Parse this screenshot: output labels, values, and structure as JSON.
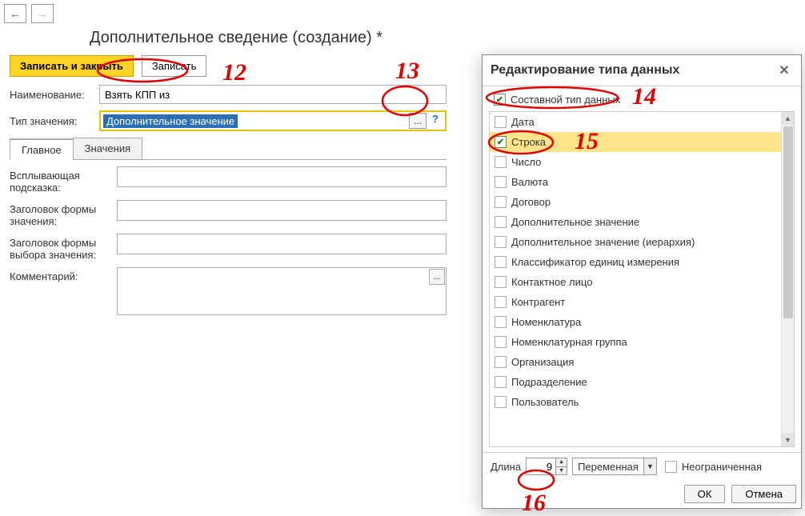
{
  "title": "Дополнительное сведение (создание) *",
  "actions": {
    "save_close": "Записать и закрыть",
    "save": "Записать"
  },
  "form": {
    "name_label": "Наименование:",
    "name_value": "Взять КПП из",
    "type_label": "Тип значения:",
    "type_value": "Дополнительное значение",
    "ellipsis": "...",
    "help": "?"
  },
  "tabs": {
    "main": "Главное",
    "values": "Значения"
  },
  "sub": {
    "tooltip_label": "Всплывающая подсказка:",
    "form_title_label": "Заголовок формы значения:",
    "choice_title_label": "Заголовок формы выбора значения:",
    "comment_label": "Комментарий:"
  },
  "popup": {
    "title": "Редактирование типа данных",
    "composite_label": "Составной тип данных",
    "types": [
      {
        "label": "Дата",
        "checked": false
      },
      {
        "label": "Строка",
        "checked": true,
        "highlight": true
      },
      {
        "label": "Число",
        "checked": false
      },
      {
        "label": "Валюта",
        "checked": false
      },
      {
        "label": "Договор",
        "checked": false
      },
      {
        "label": "Дополнительное значение",
        "checked": false
      },
      {
        "label": "Дополнительное значение (иерархия)",
        "checked": false
      },
      {
        "label": "Классификатор единиц измерения",
        "checked": false
      },
      {
        "label": "Контактное лицо",
        "checked": false
      },
      {
        "label": "Контрагент",
        "checked": false
      },
      {
        "label": "Номенклатура",
        "checked": false
      },
      {
        "label": "Номенклатурная группа",
        "checked": false
      },
      {
        "label": "Организация",
        "checked": false
      },
      {
        "label": "Подразделение",
        "checked": false
      },
      {
        "label": "Пользователь",
        "checked": false
      }
    ],
    "length_label": "Длина",
    "length_value": "9",
    "length_type": "Переменная",
    "unlimited_label": "Неограниченная",
    "ok": "ОК",
    "cancel": "Отмена"
  },
  "annotations": {
    "n12": "12",
    "n13": "13",
    "n14": "14",
    "n15": "15",
    "n16": "16"
  }
}
